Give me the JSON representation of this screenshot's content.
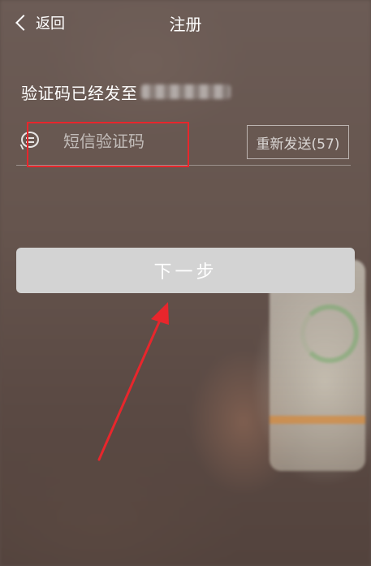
{
  "header": {
    "back_label": "返回",
    "title": "注册"
  },
  "verify": {
    "sent_text": "验证码已经发至",
    "code_placeholder": "短信验证码",
    "code_value": "",
    "resend_label": "重新发送(57)"
  },
  "actions": {
    "next_label": "下一步"
  },
  "colors": {
    "annotation_red": "#e8262c",
    "button_bg": "#d3d3d3"
  },
  "icons": {
    "back": "chevron-left-icon",
    "sms": "sms-bubble-icon"
  }
}
